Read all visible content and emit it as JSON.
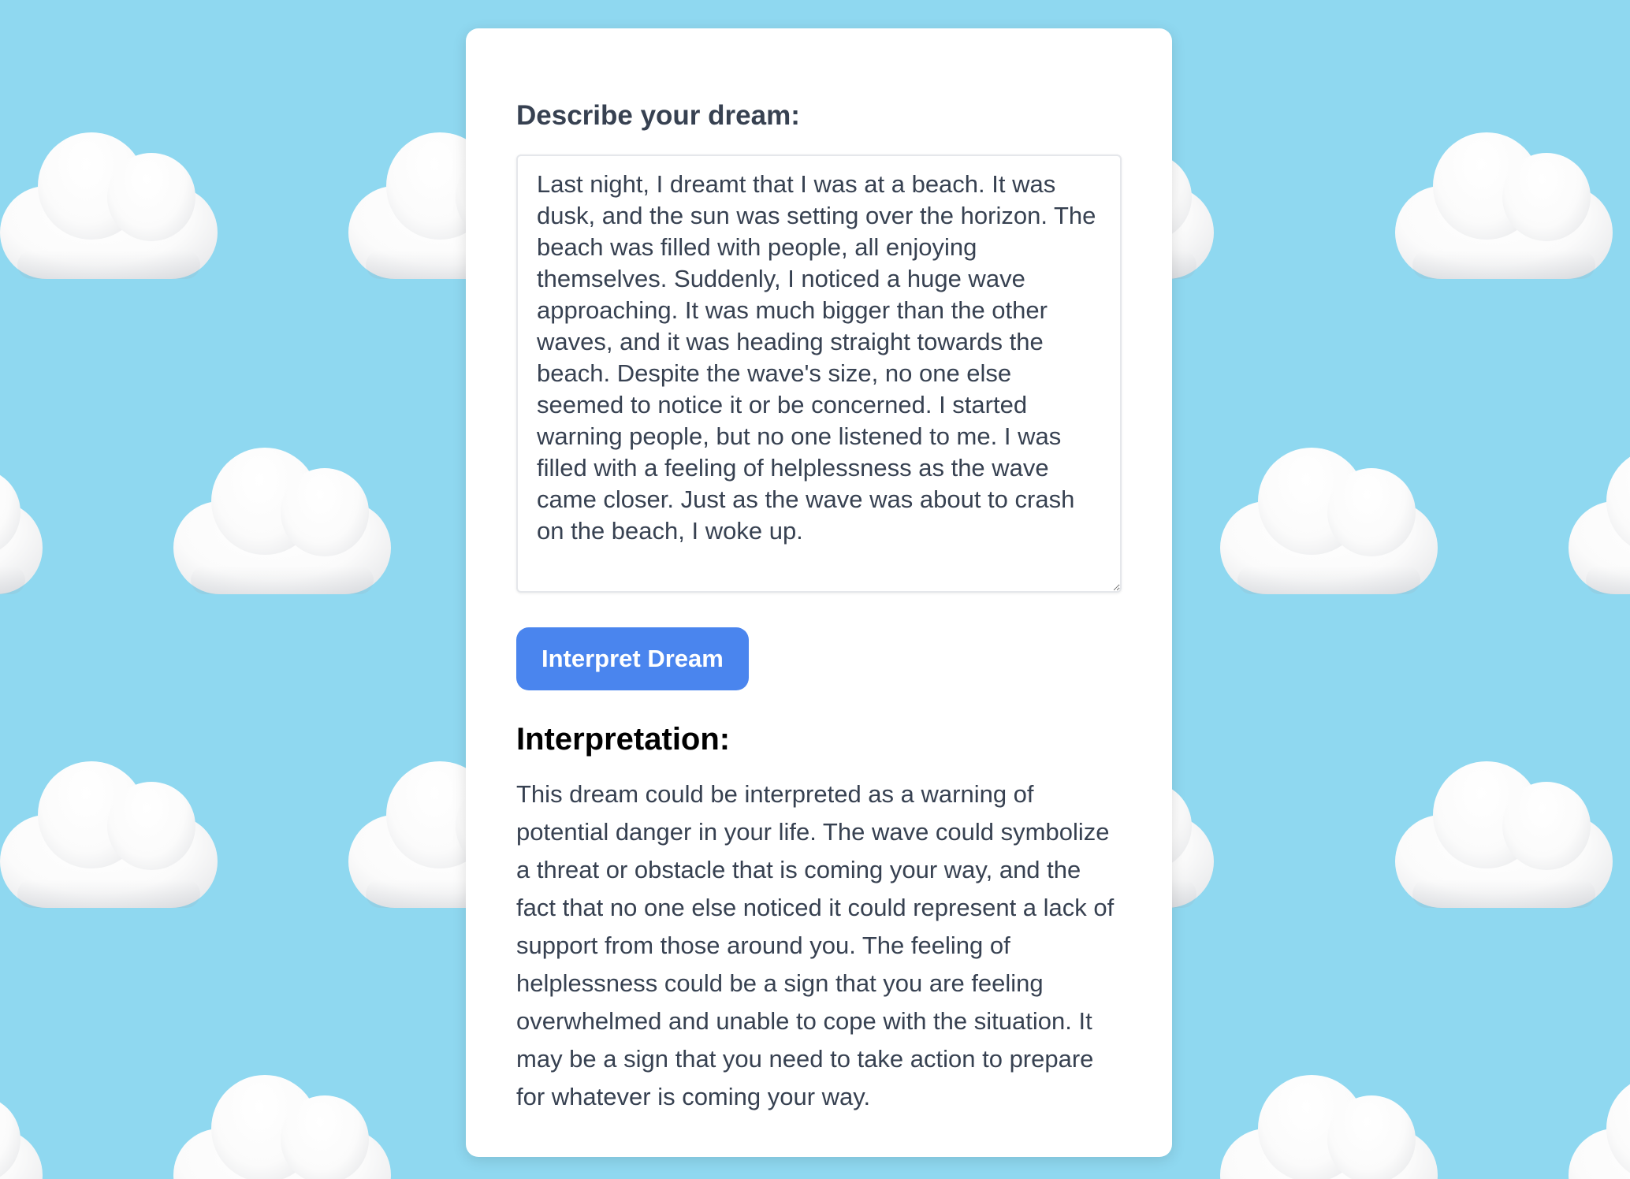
{
  "form": {
    "label": "Describe your dream:",
    "dream_text": "Last night, I dreamt that I was at a beach. It was dusk, and the sun was setting over the horizon. The beach was filled with people, all enjoying themselves. Suddenly, I noticed a huge wave approaching. It was much bigger than the other waves, and it was heading straight towards the beach. Despite the wave's size, no one else seemed to notice it or be concerned. I started warning people, but no one listened to me. I was filled with a feeling of helplessness as the wave came closer. Just as the wave was about to crash on the beach, I woke up.",
    "button_label": "Interpret Dream"
  },
  "interpretation": {
    "title": "Interpretation:",
    "text": "This dream could be interpreted as a warning of potential danger in your life. The wave could symbolize a threat or obstacle that is coming your way, and the fact that no one else noticed it could represent a lack of support from those around you. The feeling of helplessness could be a sign that you are feeling overwhelmed and unable to cope with the situation. It may be a sign that you need to take action to prepare for whatever is coming your way."
  },
  "theme": {
    "background_color": "#8fd8f0",
    "button_color": "#4a85ee",
    "text_color": "#374151"
  },
  "icons": {
    "background_pattern": "cloud-icon"
  }
}
